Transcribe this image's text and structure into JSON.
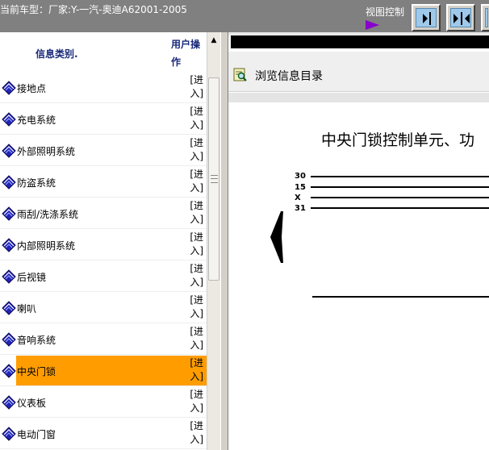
{
  "header": {
    "car_title": "当前车型：厂家:Y-一汽-奥迪A62001-2005",
    "view_control_label": "视图控制",
    "buttons": [
      {
        "icon": "collapse-right-icon"
      },
      {
        "icon": "split-view-icon"
      },
      {
        "icon": "more-icon"
      }
    ]
  },
  "left_panel": {
    "column_category": "信息类别.",
    "column_action": "用户操作",
    "selected_index": 9,
    "items": [
      {
        "label": "接地点",
        "action": "[进入]"
      },
      {
        "label": "充电系统",
        "action": "[进入]"
      },
      {
        "label": "外部照明系统",
        "action": "[进入]"
      },
      {
        "label": "防盗系统",
        "action": "[进入]"
      },
      {
        "label": "雨刮/洗涤系统",
        "action": "[进入]"
      },
      {
        "label": "内部照明系统",
        "action": "[进入]"
      },
      {
        "label": "后视镜",
        "action": "[进入]"
      },
      {
        "label": "喇叭",
        "action": "[进入]"
      },
      {
        "label": "音响系统",
        "action": "[进入]"
      },
      {
        "label": "中央门锁",
        "action": "[进入]"
      },
      {
        "label": "仪表板",
        "action": "[进入]"
      },
      {
        "label": "电动门窗",
        "action": "[进入]"
      }
    ]
  },
  "right_panel": {
    "browse_label": "浏览信息目录",
    "doc_title": "中央门锁控制单元、功",
    "wire_labels": [
      "30",
      "15",
      "X",
      "31"
    ]
  },
  "colors": {
    "top_bar": "#808080",
    "selected_row": "#ff9d00",
    "header_text": "#1a2a7a"
  }
}
